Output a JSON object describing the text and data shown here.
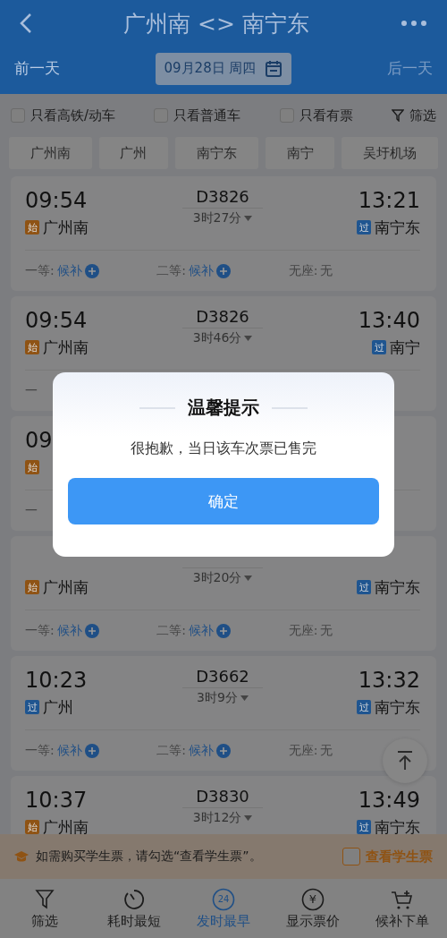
{
  "header": {
    "title": "广州南 <> 南宁东"
  },
  "date_bar": {
    "prev": "前一天",
    "date": "09月28日 周四",
    "next": "后一天",
    "next_disabled": true
  },
  "filters": [
    {
      "label": "只看高铁/动车",
      "checked": false
    },
    {
      "label": "只看普通车",
      "checked": false
    },
    {
      "label": "只看有票",
      "checked": false
    }
  ],
  "filter_button": "筛选",
  "stations": [
    {
      "label": "广州南"
    },
    {
      "label": "广州"
    },
    {
      "label": "南宁东"
    },
    {
      "label": "南宁"
    },
    {
      "label": "吴圩机场"
    }
  ],
  "trains": [
    {
      "depart_time": "09:54",
      "depart_badge": {
        "text": "始",
        "color": "#8f5314"
      },
      "depart_station": "广州南",
      "train_no": "D3826",
      "duration": "3时27分",
      "arrive_time": "13:21",
      "arrive_badge": {
        "text": "过",
        "color": "#1f5590"
      },
      "arrive_station": "南宁东",
      "seats": [
        {
          "kind": "waitlist",
          "label": "一等:",
          "value": "候补"
        },
        {
          "kind": "waitlist",
          "label": "二等:",
          "value": "候补"
        },
        {
          "kind": "none",
          "label": "无座:",
          "value": "无"
        }
      ]
    },
    {
      "depart_time": "09:54",
      "depart_badge": {
        "text": "始",
        "color": "#8f5314"
      },
      "depart_station": "广州南",
      "train_no": "D3826",
      "duration": "3时46分",
      "arrive_time": "13:40",
      "arrive_badge": {
        "text": "过",
        "color": "#1f5590"
      },
      "arrive_station": "南宁",
      "seats": [
        {
          "kind": "none",
          "label": "一"
        }
      ]
    },
    {
      "depart_time": "09",
      "depart_badge": {
        "text": "始",
        "color": "#8f5314"
      },
      "seats": [
        {
          "kind": "none",
          "label": "一"
        }
      ]
    },
    {
      "depart_badge": {
        "text": "始",
        "color": "#8f5314"
      },
      "depart_station": "广州南",
      "duration": "3时20分",
      "arrive_badge": {
        "text": "过",
        "color": "#1f5590"
      },
      "arrive_station": "南宁东",
      "seats": [
        {
          "kind": "waitlist",
          "label": "一等:",
          "value": "候补"
        },
        {
          "kind": "waitlist",
          "label": "二等:",
          "value": "候补"
        },
        {
          "kind": "none",
          "label": "无座:",
          "value": "无"
        }
      ]
    },
    {
      "depart_time": "10:23",
      "depart_badge": {
        "text": "过",
        "color": "#1f5590"
      },
      "depart_station": "广州",
      "train_no": "D3662",
      "duration": "3时9分",
      "arrive_time": "13:32",
      "arrive_badge": {
        "text": "过",
        "color": "#1f5590"
      },
      "arrive_station": "南宁东",
      "seats": [
        {
          "kind": "waitlist",
          "label": "一等:",
          "value": "候补"
        },
        {
          "kind": "waitlist",
          "label": "二等:",
          "value": "候补"
        },
        {
          "kind": "none",
          "label": "无座:",
          "value": "无"
        }
      ]
    },
    {
      "depart_time": "10:37",
      "depart_badge": {
        "text": "始",
        "color": "#8f5314"
      },
      "depart_station": "广州南",
      "train_no": "D3830",
      "duration": "3时12分",
      "arrive_time": "13:49",
      "arrive_badge": {
        "text": "过",
        "color": "#1f5590"
      },
      "arrive_station": "南宁东"
    }
  ],
  "student_notice": {
    "text": "如需购买学生票，请勾选“查看学生票”。",
    "checkbox_label": "查看学生票",
    "checked": false
  },
  "bottom_nav": [
    {
      "kind": "filter",
      "label": "筛选",
      "selected": false
    },
    {
      "kind": "timer",
      "label": "耗时最短",
      "selected": false
    },
    {
      "kind": "clock24",
      "icon_text": "24",
      "label": "发时最早",
      "selected": true
    },
    {
      "kind": "price",
      "icon_text": "¥",
      "label": "显示票价",
      "selected": false
    },
    {
      "kind": "cart",
      "label": "候补下单",
      "selected": false
    }
  ],
  "dialog": {
    "title": "温馨提示",
    "message": "很抱歉，当日该车次票已售完",
    "button": "确定"
  }
}
